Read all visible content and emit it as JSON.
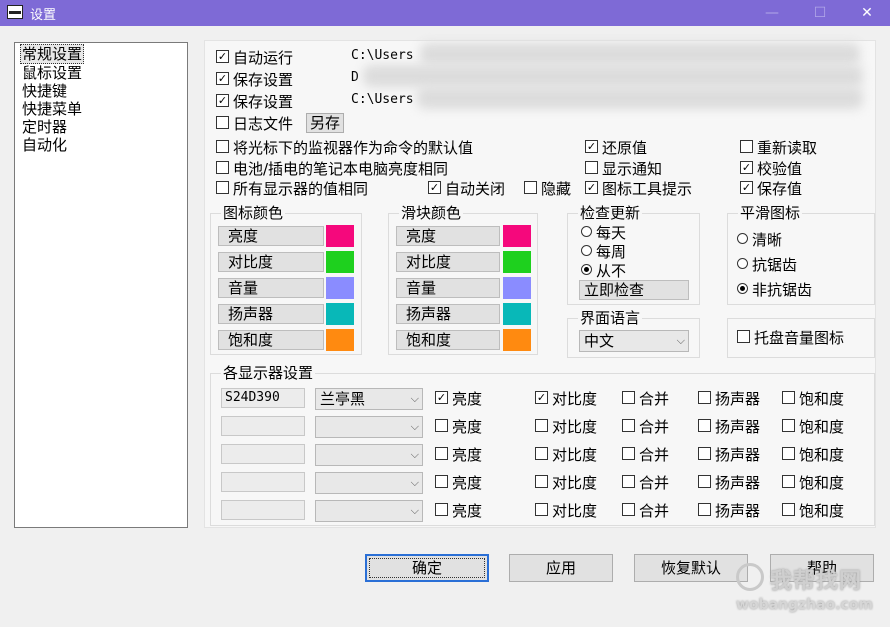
{
  "window": {
    "title": "设置",
    "minimize": "—",
    "maximize": "☐",
    "close": "✕"
  },
  "sidebar": {
    "items": [
      "常规设置",
      "鼠标设置",
      "快捷键",
      "快捷菜单",
      "定时器",
      "自动化"
    ]
  },
  "general": {
    "autorun": {
      "label": "自动运行",
      "checked": true,
      "path": "C:\\Users"
    },
    "save_settings": {
      "label": "保存设置",
      "checked": true,
      "path": "D"
    },
    "save_settings2": {
      "label": "保存设置",
      "checked": true,
      "path": "C:\\Users"
    },
    "log_file": {
      "label": "日志文件",
      "checked": false,
      "saveas": "另存"
    },
    "options": [
      {
        "label": "将光标下的监视器作为命令的默认值",
        "checked": false
      },
      {
        "label": "电池/插电的笔记本电脑亮度相同",
        "checked": false
      },
      {
        "label": "所有显示器的值相同",
        "checked": false
      },
      {
        "label": "自动关闭",
        "checked": true
      },
      {
        "label": "隐藏",
        "checked": false
      },
      {
        "label": "还原值",
        "checked": true
      },
      {
        "label": "显示通知",
        "checked": false
      },
      {
        "label": "图标工具提示",
        "checked": true
      },
      {
        "label": "重新读取",
        "checked": false
      },
      {
        "label": "校验值",
        "checked": true
      },
      {
        "label": "保存值",
        "checked": true
      }
    ]
  },
  "icon_colors": {
    "title": "图标颜色",
    "items": [
      {
        "label": "亮度",
        "color": "#f5087c"
      },
      {
        "label": "对比度",
        "color": "#1ed01e"
      },
      {
        "label": "音量",
        "color": "#8a8cff"
      },
      {
        "label": "扬声器",
        "color": "#08b8b8"
      },
      {
        "label": "饱和度",
        "color": "#ff8a10"
      }
    ]
  },
  "slider_colors": {
    "title": "滑块颜色",
    "items": [
      {
        "label": "亮度",
        "color": "#f5087c"
      },
      {
        "label": "对比度",
        "color": "#1ed01e"
      },
      {
        "label": "音量",
        "color": "#8a8cff"
      },
      {
        "label": "扬声器",
        "color": "#08b8b8"
      },
      {
        "label": "饱和度",
        "color": "#ff8a10"
      }
    ]
  },
  "update_check": {
    "title": "检查更新",
    "options": [
      {
        "label": "每天",
        "selected": false
      },
      {
        "label": "每周",
        "selected": false
      },
      {
        "label": "从不",
        "selected": true
      }
    ],
    "check_now": "立即检查"
  },
  "smooth_icon": {
    "title": "平滑图标",
    "options": [
      {
        "label": "清晰",
        "selected": false
      },
      {
        "label": "抗锯齿",
        "selected": false
      },
      {
        "label": "非抗锯齿",
        "selected": true
      }
    ]
  },
  "ui_language": {
    "title": "界面语言",
    "value": "中文"
  },
  "tray_volume": {
    "label": "托盘音量图标",
    "checked": false
  },
  "monitors": {
    "title": "各显示器设置",
    "columns": [
      "亮度",
      "对比度",
      "合并",
      "扬声器",
      "饱和度"
    ],
    "rows": [
      {
        "name": "S24D390",
        "font": "兰亭黑",
        "checks": [
          true,
          true,
          false,
          false,
          false
        ]
      },
      {
        "name": "",
        "font": "",
        "checks": [
          false,
          false,
          false,
          false,
          false
        ]
      },
      {
        "name": "",
        "font": "",
        "checks": [
          false,
          false,
          false,
          false,
          false
        ]
      },
      {
        "name": "",
        "font": "",
        "checks": [
          false,
          false,
          false,
          false,
          false
        ]
      },
      {
        "name": "",
        "font": "",
        "checks": [
          false,
          false,
          false,
          false,
          false
        ]
      }
    ]
  },
  "buttons": {
    "ok": "确定",
    "apply": "应用",
    "reset": "恢复默认",
    "help": "帮助"
  },
  "watermark": {
    "text": "我帮找网",
    "sub": "wobangzhao.com"
  }
}
